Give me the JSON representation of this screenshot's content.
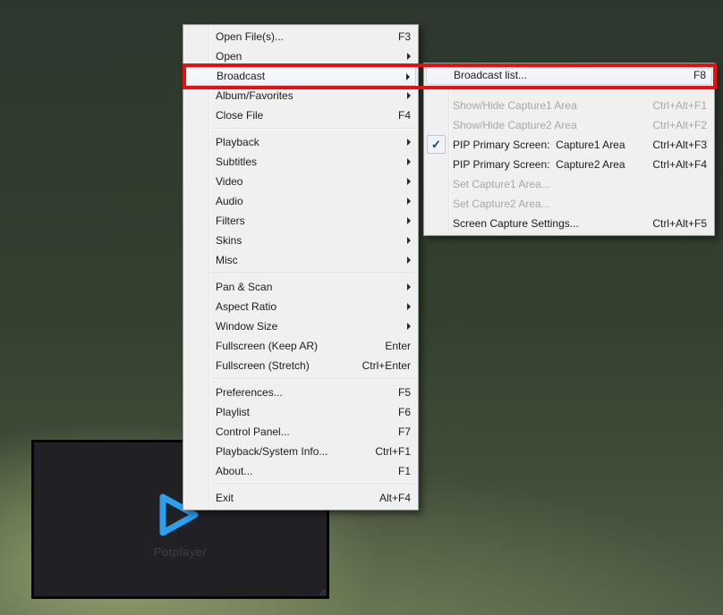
{
  "app": {
    "name": "PotPlayer context menu"
  },
  "colors": {
    "annotation_red": "#e90f10",
    "menu_bg": "#f0f0f0",
    "menu_border": "#9b9b9b",
    "disabled_text": "#a7a7a7",
    "logo_blue": "#2b9ff0"
  },
  "main_menu": {
    "items": [
      {
        "label": "Open File(s)...",
        "shortcut": "F3"
      },
      {
        "label": "Open",
        "submenu": true
      },
      {
        "label": "Broadcast",
        "submenu": true,
        "highlight": true
      },
      {
        "label": "Album/Favorites",
        "submenu": true
      },
      {
        "label": "Close File",
        "shortcut": "F4"
      },
      {
        "separator": true
      },
      {
        "label": "Playback",
        "submenu": true
      },
      {
        "label": "Subtitles",
        "submenu": true
      },
      {
        "label": "Video",
        "submenu": true
      },
      {
        "label": "Audio",
        "submenu": true
      },
      {
        "label": "Filters",
        "submenu": true
      },
      {
        "label": "Skins",
        "submenu": true
      },
      {
        "label": "Misc",
        "submenu": true
      },
      {
        "separator": true
      },
      {
        "label": "Pan & Scan",
        "submenu": true
      },
      {
        "label": "Aspect Ratio",
        "submenu": true
      },
      {
        "label": "Window Size",
        "submenu": true
      },
      {
        "label": "Fullscreen (Keep AR)",
        "shortcut": "Enter"
      },
      {
        "label": "Fullscreen (Stretch)",
        "shortcut": "Ctrl+Enter"
      },
      {
        "separator": true
      },
      {
        "label": "Preferences...",
        "shortcut": "F5"
      },
      {
        "label": "Playlist",
        "shortcut": "F6"
      },
      {
        "label": "Control Panel...",
        "shortcut": "F7"
      },
      {
        "label": "Playback/System Info...",
        "shortcut": "Ctrl+F1"
      },
      {
        "label": "About...",
        "shortcut": "F1"
      },
      {
        "separator": true
      },
      {
        "label": "Exit",
        "shortcut": "Alt+F4"
      }
    ]
  },
  "submenu": {
    "items": [
      {
        "label": "Broadcast list...",
        "shortcut": "F8",
        "highlight": true
      },
      {
        "separator": true
      },
      {
        "label": "Show/Hide Capture1 Area",
        "shortcut": "Ctrl+Alt+F1",
        "disabled": true
      },
      {
        "label": "Show/Hide Capture2 Area",
        "shortcut": "Ctrl+Alt+F2",
        "disabled": true
      },
      {
        "label": "PIP Primary Screen:  Capture1 Area",
        "shortcut": "Ctrl+Alt+F3",
        "checked": true
      },
      {
        "label": "PIP Primary Screen:  Capture2 Area",
        "shortcut": "Ctrl+Alt+F4"
      },
      {
        "label": "Set Capture1 Area...",
        "disabled": true
      },
      {
        "label": "Set Capture2 Area...",
        "disabled": true
      },
      {
        "label": "Screen Capture Settings...",
        "shortcut": "Ctrl+Alt+F5"
      }
    ]
  },
  "player_window": {
    "logo_text": "Potplayer",
    "logo_color": "#2b9ff0"
  }
}
